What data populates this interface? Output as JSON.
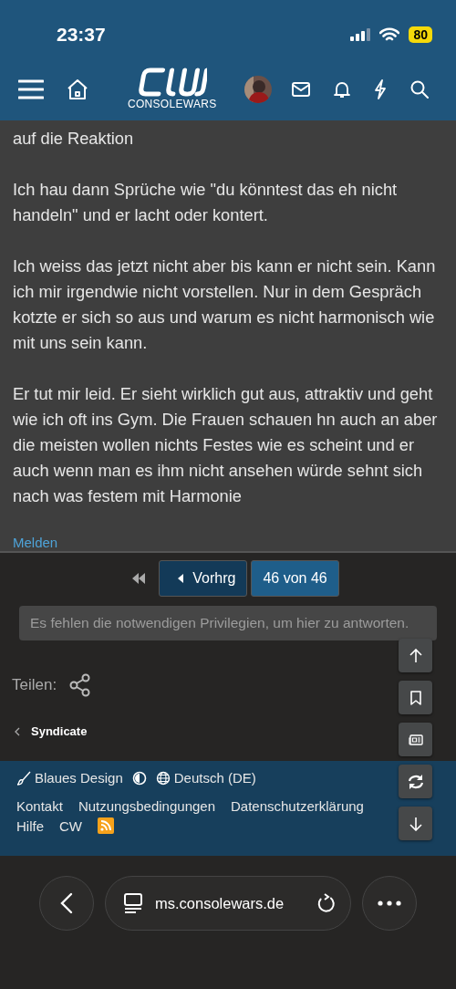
{
  "status_bar": {
    "time": "23:37",
    "battery": "80"
  },
  "header": {
    "logo_text": "CONSOLEWARS"
  },
  "post": {
    "paragraphs": [
      "auf die Reaktion",
      "Ich hau dann Sprüche wie \"du könntest das eh nicht handeln\" und er lacht oder kontert.",
      "Ich weiss das jetzt nicht aber bis kann er nicht sein. Kann ich mir irgendwie nicht vorstellen. Nur in dem Gespräch kotzte er sich so aus und warum es nicht harmonisch wie mit uns sein kann.",
      "Er tut mir leid. Er sieht wirklich gut aus, attraktiv und geht wie ich oft ins Gym. Die Frauen schauen hn auch an aber die meisten wollen nichts Festes wie es scheint und er auch wenn man es ihm nicht ansehen würde sehnt sich nach was festem mit Harmonie"
    ],
    "report_link": "Melden"
  },
  "pagination": {
    "prev": "Vorhrg",
    "current": "46 von 46"
  },
  "reply_notice": "Es fehlen die notwendigen Privilegien, um hier zu antworten.",
  "share": {
    "label": "Teilen:"
  },
  "breadcrumb": "Syndicate",
  "footer": {
    "style": "Blaues Design",
    "language": "Deutsch (DE)",
    "links": [
      "Kontakt",
      "Nutzungsbedingungen",
      "Datenschutzerklärung",
      "Hilfe",
      "CW"
    ]
  },
  "browser": {
    "url": "ms.consolewars.de"
  }
}
